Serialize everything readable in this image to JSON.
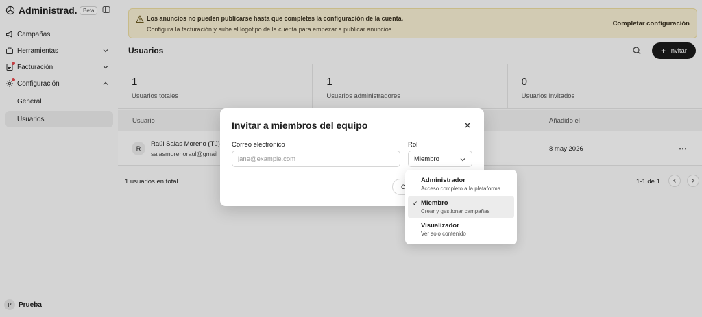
{
  "sidebar": {
    "app_title": "Administrad...",
    "beta_badge": "Beta",
    "items": [
      {
        "label": "Campañas",
        "icon": "megaphone-icon"
      },
      {
        "label": "Herramientas",
        "icon": "briefcase-icon"
      },
      {
        "label": "Facturación",
        "icon": "invoice-icon",
        "notification": true
      },
      {
        "label": "Configuración",
        "icon": "gear-icon",
        "notification": true
      }
    ],
    "sub_items": [
      {
        "label": "General"
      },
      {
        "label": "Usuarios",
        "active": true
      }
    ],
    "org_initial": "P",
    "org_name": "Prueba"
  },
  "banner": {
    "title": "Los anuncios no pueden publicarse hasta que completes la configuración de la cuenta.",
    "description": "Configura la facturación y sube el logotipo de la cuenta para empezar a publicar anuncios.",
    "action": "Completar configuración"
  },
  "page": {
    "title": "Usuarios",
    "invite_label": "Invitar"
  },
  "stats": [
    {
      "value": "1",
      "label": "Usuarios totales"
    },
    {
      "value": "1",
      "label": "Usuarios administradores"
    },
    {
      "value": "0",
      "label": "Usuarios invitados"
    }
  ],
  "table": {
    "col_user": "Usuario",
    "col_added": "Añadido el",
    "rows": [
      {
        "initial": "R",
        "name": "Raúl Salas Moreno (Tú)",
        "email": "salasmorenoraul@gmail",
        "added": "8 may 2026",
        "more": "⋯"
      }
    ],
    "total": "1 usuarios en total",
    "pagination": "1-1 de 1"
  },
  "modal": {
    "title": "Invitar a miembros del equipo",
    "email_label": "Correo electrónico",
    "email_placeholder": "jane@example.com",
    "role_label": "Rol",
    "role_value": "Miembro",
    "cancel_partial": "C"
  },
  "role_options": [
    {
      "title": "Administrador",
      "desc": "Acceso completo a la plataforma"
    },
    {
      "title": "Miembro",
      "desc": "Crear y gestionar campañas",
      "selected": true,
      "check": "✓"
    },
    {
      "title": "Visualizador",
      "desc": "Ver solo contenido"
    }
  ],
  "colors": {
    "banner_bg": "#f7efd3",
    "primary_button": "#1a1a1a",
    "notification_dot": "#e5484d"
  }
}
